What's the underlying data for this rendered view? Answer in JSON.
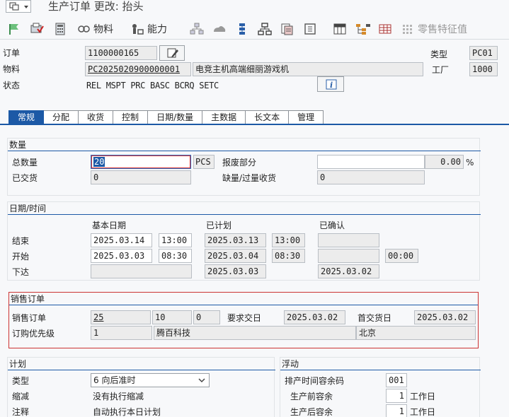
{
  "window": {
    "title": "生产订单 更改: 抬头"
  },
  "toolbar": {
    "material_label": "物料",
    "capacity_label": "能力",
    "retail_label": "零售特征值"
  },
  "header": {
    "order_label": "订单",
    "order_value": "1100000165",
    "material_label": "物料",
    "material_value": "PC2025020900000001",
    "material_desc": "电竞主机高端细丽游戏机",
    "status_label": "状态",
    "status_value": "REL  MSPT PRC  BASC BCRQ SETC",
    "type_label": "类型",
    "type_value": "PC01",
    "plant_label": "工厂",
    "plant_value": "1000"
  },
  "tabs": [
    {
      "label": "常规",
      "active": true
    },
    {
      "label": "分配"
    },
    {
      "label": "收货"
    },
    {
      "label": "控制"
    },
    {
      "label": "日期/数量"
    },
    {
      "label": "主数据"
    },
    {
      "label": "长文本"
    },
    {
      "label": "管理"
    }
  ],
  "quantity": {
    "title": "数量",
    "total_label": "总数量",
    "total_value": "20",
    "unit": "PCS",
    "scrap_label": "报废部分",
    "scrap_value": "",
    "scrap_pct": "0.00",
    "pct_sign": "%",
    "delivered_label": "已交货",
    "delivered_value": "0",
    "shortage_label": "缺量/过量收货",
    "shortage_value": "0"
  },
  "dates": {
    "title": "日期/时间",
    "col_basic": "基本日期",
    "col_scheduled": "已计划",
    "col_confirmed": "已确认",
    "end_label": "结束",
    "end_basic_date": "2025.03.14",
    "end_basic_time": "13:00",
    "end_sched_date": "2025.03.13",
    "end_sched_time": "13:00",
    "start_label": "开始",
    "start_basic_date": "2025.03.03",
    "start_basic_time": "08:30",
    "start_sched_date": "2025.03.04",
    "start_sched_time": "08:30",
    "start_conf_time": "00:00",
    "release_label": "下达",
    "release_sched_date": "2025.03.03",
    "release_conf_date": "2025.03.02"
  },
  "sales": {
    "title": "销售订单",
    "so_label": "销售订单",
    "so_value": "25",
    "item_value": "10",
    "sched_value": "0",
    "req_date_label": "要求交日",
    "req_date_value": "2025.03.02",
    "first_date_label": "首交货日",
    "first_date_value": "2025.03.02",
    "priority_label": "订购优先级",
    "priority_value": "1",
    "customer_value": "腾百科技",
    "city_value": "北京"
  },
  "plan": {
    "title": "计划",
    "type_label": "类型",
    "type_value": "6 向后准时",
    "reduce_label": "缩减",
    "reduce_value": "没有执行缩减",
    "note_label": "注释",
    "note_value": "自动执行本日计划"
  },
  "float": {
    "title": "浮动",
    "sched_margin_label": "排产时间容余码",
    "sched_margin_value": "001",
    "pre_label": "生产前容余",
    "pre_value": "1",
    "pre_unit": "工作日",
    "post_label": "生产后容余",
    "post_value": "1",
    "post_unit": "工作日"
  },
  "colors": {
    "accent": "#1c59a6",
    "highlight_border": "#cc3333"
  }
}
